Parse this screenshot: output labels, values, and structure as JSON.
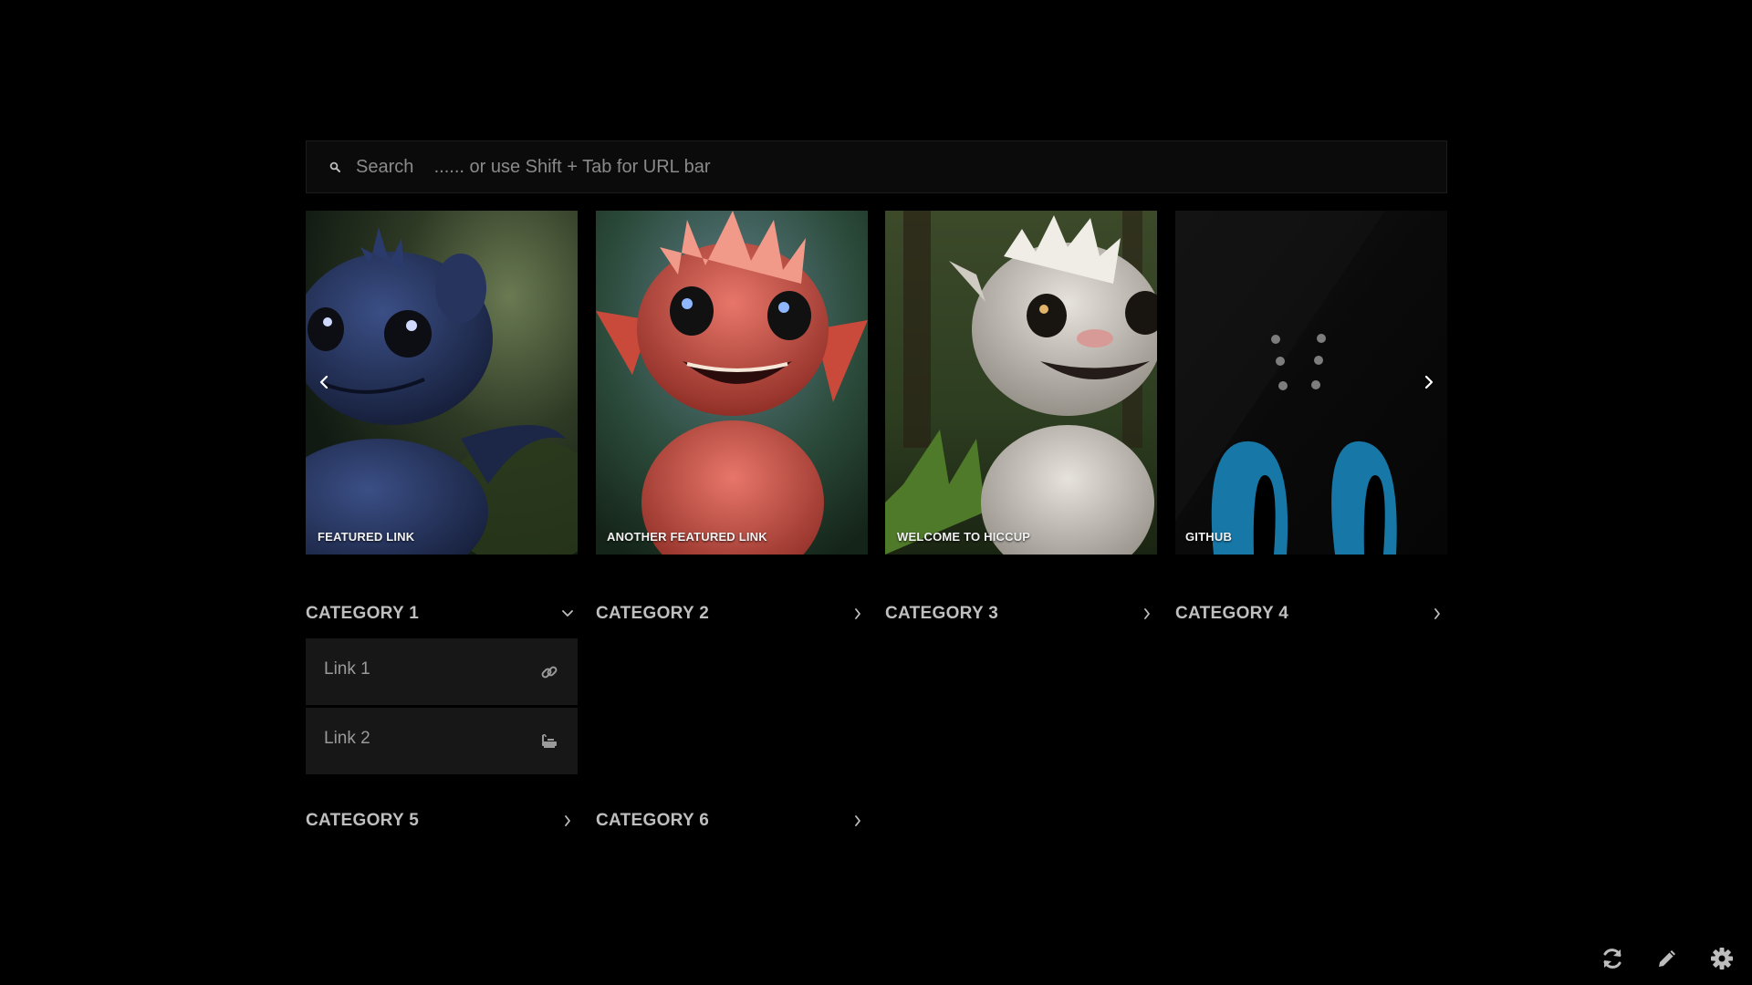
{
  "search": {
    "placeholder": "Search    ...... or use Shift + Tab for URL bar",
    "icon": "search-icon"
  },
  "featured": {
    "cards": [
      {
        "label": "FEATURED LINK",
        "image": "blue-baby-dragon"
      },
      {
        "label": "ANOTHER FEATURED LINK",
        "image": "red-baby-dragon"
      },
      {
        "label": "WELCOME TO HICCUP",
        "image": "white-baby-dragon"
      },
      {
        "label": "GITHUB",
        "image": "dark-creature-eyes"
      }
    ],
    "prev_icon": "chevron-left-icon",
    "next_icon": "chevron-right-icon"
  },
  "categories": [
    {
      "title": "CATEGORY 1",
      "expanded": true,
      "links": [
        {
          "label": "Link 1",
          "icon": "link-icon"
        },
        {
          "label": "Link 2",
          "icon": "bathtub-icon"
        }
      ]
    },
    {
      "title": "CATEGORY 2",
      "expanded": false
    },
    {
      "title": "CATEGORY 3",
      "expanded": false
    },
    {
      "title": "CATEGORY 4",
      "expanded": false
    },
    {
      "title": "CATEGORY 5",
      "expanded": false
    },
    {
      "title": "CATEGORY 6",
      "expanded": false
    }
  ],
  "toolbar": {
    "refresh_icon": "refresh-icon",
    "edit_icon": "pencil-icon",
    "settings_icon": "gear-icon"
  },
  "colors": {
    "background": "#000000",
    "panel": "#171717",
    "text": "#bfbfbf",
    "accent_blue": "#1778a8"
  }
}
